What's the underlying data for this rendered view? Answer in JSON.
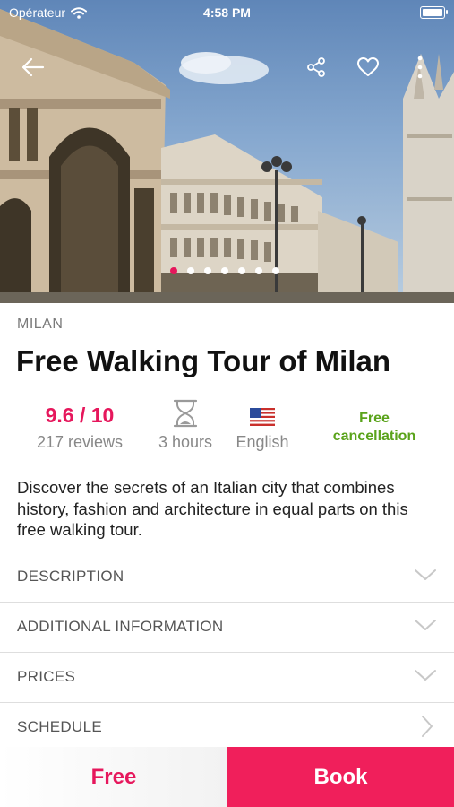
{
  "status_bar": {
    "carrier": "Opérateur",
    "time": "4:58 PM"
  },
  "hero": {
    "photo_count": 7,
    "active_index": 0
  },
  "tour": {
    "city": "MILAN",
    "title": "Free Walking Tour of Milan",
    "rating": "9.6 / 10",
    "reviews": "217 reviews",
    "duration": "3 hours",
    "language": "English",
    "cancellation_line1": "Free",
    "cancellation_line2": "cancellation",
    "summary": "Discover the secrets of an Italian city that combines history, fashion and architecture in equal parts on this free walking tour."
  },
  "sections": [
    {
      "label": "DESCRIPTION",
      "icon": "chevron-down-icon"
    },
    {
      "label": "ADDITIONAL INFORMATION",
      "icon": "chevron-down-icon"
    },
    {
      "label": "PRICES",
      "icon": "chevron-down-icon"
    },
    {
      "label": "SCHEDULE",
      "icon": "chevron-right-icon"
    }
  ],
  "footer": {
    "price_label": "Free",
    "book_label": "Book"
  },
  "colors": {
    "accent": "#e6175c",
    "book_button": "#f01f5b",
    "cancellation": "#5aa31b"
  }
}
